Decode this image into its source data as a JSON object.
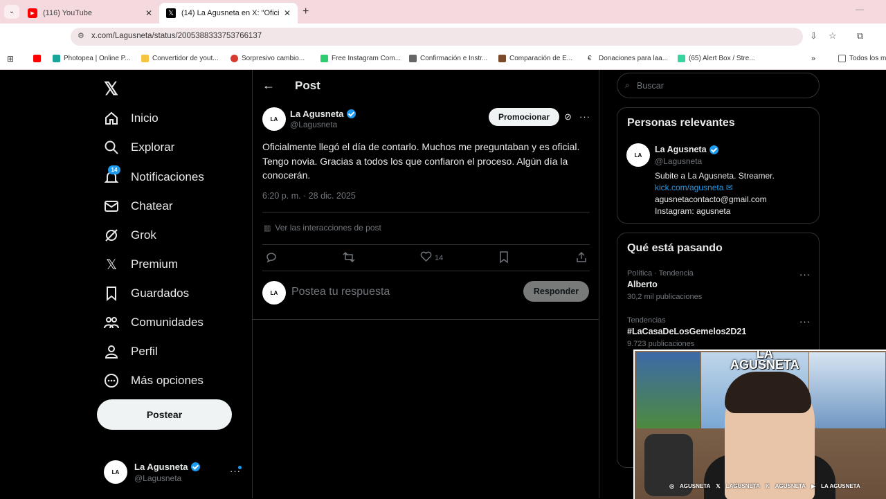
{
  "browser": {
    "tabs": [
      {
        "title": "(116) YouTube",
        "active": false
      },
      {
        "title": "(14) La Agusneta en X: \"Oficialm",
        "active": true
      }
    ],
    "url": "x.com/Lagusneta/status/2005388333753766137",
    "bookmarks": [
      {
        "label": "Photopea | Online P...",
        "color": "#18a497"
      },
      {
        "label": "Convertidor de yout...",
        "color": "#f5c542"
      },
      {
        "label": "Sorpresivo cambio...",
        "color": "#d9382f"
      },
      {
        "label": "Free Instagram Com...",
        "color": "#2ecc71"
      },
      {
        "label": "Confirmación e Instr...",
        "color": "#666666"
      },
      {
        "label": "Comparación de E...",
        "color": "#7a4a2a"
      },
      {
        "label": "Donaciones para laa...",
        "color": "#333333"
      },
      {
        "label": "(65) Alert Box / Stre...",
        "color": "#38d39f"
      },
      {
        "label": "Todos los m",
        "color": "#888888"
      }
    ]
  },
  "sidebar": {
    "items": [
      {
        "label": "Inicio",
        "icon": "home-icon"
      },
      {
        "label": "Explorar",
        "icon": "search-icon"
      },
      {
        "label": "Notificaciones",
        "icon": "bell-icon"
      },
      {
        "label": "Chatear",
        "icon": "mail-icon"
      },
      {
        "label": "Grok",
        "icon": "grok-icon"
      },
      {
        "label": "Premium",
        "icon": "x-logo-icon"
      },
      {
        "label": "Guardados",
        "icon": "bookmark-icon"
      },
      {
        "label": "Comunidades",
        "icon": "people-icon"
      },
      {
        "label": "Perfil",
        "icon": "person-icon"
      },
      {
        "label": "Más opciones",
        "icon": "more-circle-icon"
      }
    ],
    "notif_count": "14",
    "post_label": "Postear",
    "account": {
      "name": "La Agusneta",
      "handle": "@Lagusneta"
    }
  },
  "post": {
    "header": "Post",
    "author": {
      "name": "La Agusneta",
      "handle": "@Lagusneta"
    },
    "promote_label": "Promocionar",
    "text": "Oficialmente llegó el día de contarlo. Muchos me preguntaban y es oficial. Tengo novia. Gracias a todos los que confiaron el proceso. Algún día la conocerán.",
    "time": "6:20 p. m. · 28 dic. 2025",
    "interactions_label": "Ver las interacciones de post",
    "likes": "14",
    "reply_placeholder": "Postea tu respuesta",
    "reply_button": "Responder"
  },
  "right": {
    "search_placeholder": "Buscar",
    "relevant": {
      "title": "Personas relevantes",
      "name": "La Agusneta",
      "handle": "@Lagusneta",
      "bio1": "Subite a La Agusneta. Streamer.",
      "bio_link": "kick.com/agusneta",
      "bio2": "agusnetacontacto@gmail.com",
      "bio3": "Instagram: agusneta"
    },
    "trending": {
      "title": "Qué está pasando",
      "items": [
        {
          "context": "Política · Tendencia",
          "topic": "Alberto",
          "count": "30,2 mil publicaciones"
        },
        {
          "context": "Tendencias",
          "topic": "#LaCasaDeLosGemelos2D21",
          "count": "9.723 publicaciones"
        }
      ]
    }
  },
  "overlay": {
    "brand": "LA AGUSNETA",
    "socials": [
      "AGUSNETA",
      "LAGUSNETA",
      "AGUSNETA",
      "LA AGUSNETA"
    ]
  }
}
